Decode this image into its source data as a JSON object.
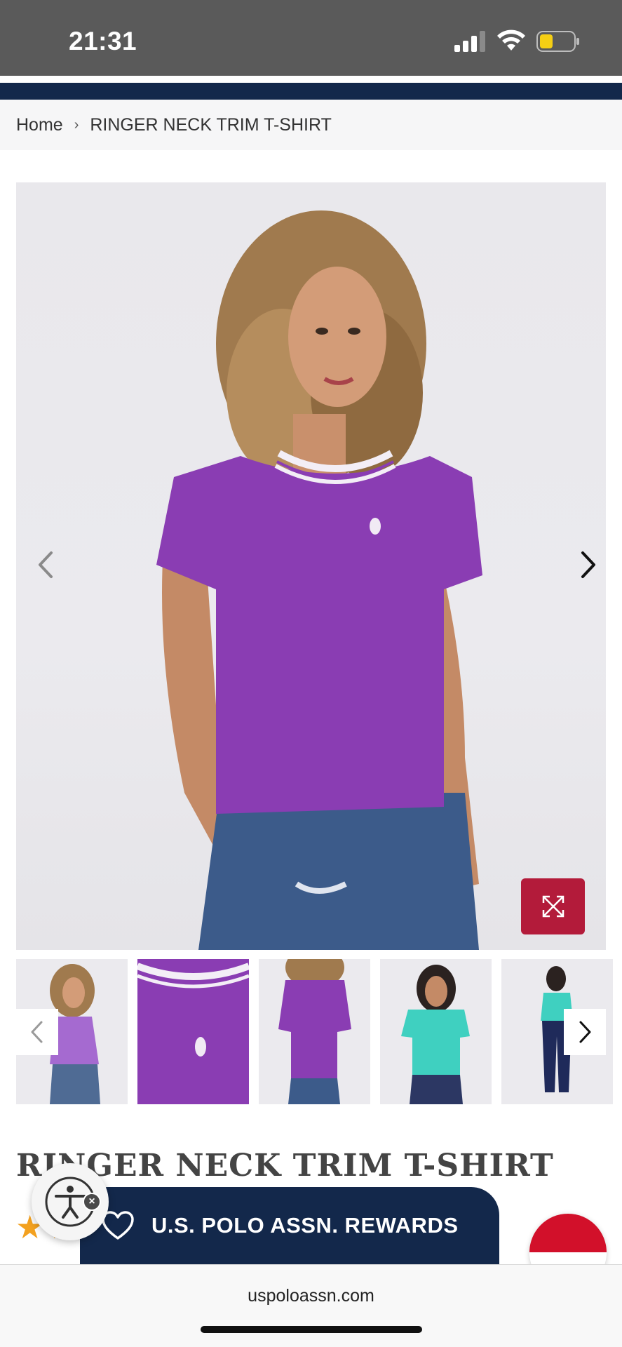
{
  "status_bar": {
    "time": "21:31",
    "icons": [
      "cellular-signal-icon",
      "wifi-icon",
      "battery-low-icon"
    ]
  },
  "breadcrumb": {
    "home": "Home",
    "separator": "›",
    "current": "RINGER NECK TRIM T-SHIRT"
  },
  "product": {
    "title": "RINGER NECK TRIM T-SHIRT",
    "color": "#8a3db3",
    "rating_stars_visible": 2
  },
  "gallery": {
    "prev_icon": "chevron-left-icon",
    "next_icon": "chevron-right-icon",
    "expand_icon": "expand-icon",
    "thumbnail_count": 5
  },
  "rewards": {
    "label": "U.S. POLO ASSN. REWARDS"
  },
  "browser": {
    "url": "uspoloassn.com"
  },
  "colors": {
    "brand_navy": "#13284b",
    "accent_red": "#b31b3a",
    "star": "#f3a11f",
    "shirt_purple": "#8a3db3",
    "shirt_teal": "#3fd0c0"
  }
}
